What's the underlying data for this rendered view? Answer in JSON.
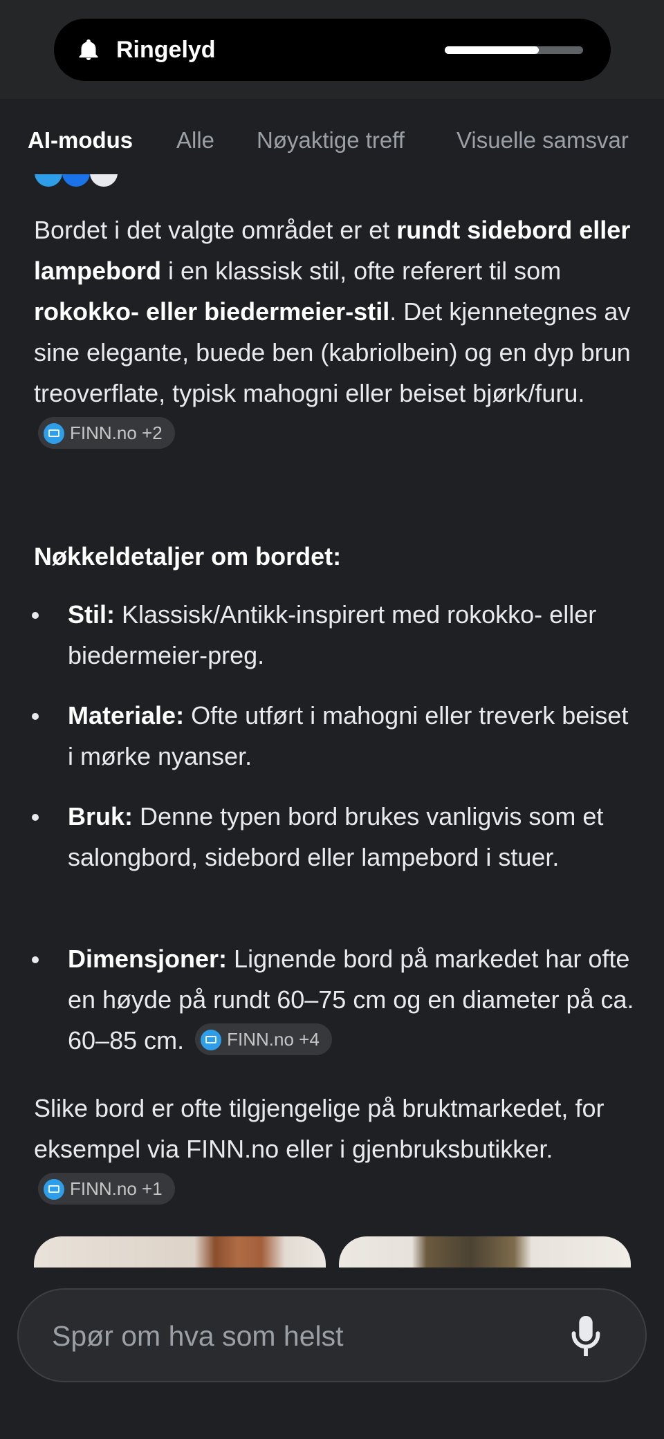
{
  "volume": {
    "label": "Ringelyd",
    "level": 0.68
  },
  "tabs": [
    "AI-modus",
    "Alle",
    "Nøyaktige treff",
    "Visuelle samsvar"
  ],
  "intro": {
    "t1": "Bordet i det valgte området er et ",
    "b1": "rundt sidebord eller lampebord",
    "t2": " i en klassisk stil, ofte referert til som ",
    "b2": "rokokko- eller biedermeier-stil",
    "t3": ". Det kjennetegnes av sine elegante, buede ben (kabriolbein) og en dyp brun treoverflate, typisk mahogni eller beiset bjørk/furu.",
    "chip": "FINN.no +2"
  },
  "details_heading": "Nøkkeldetaljer om bordet:",
  "details": [
    {
      "label": "Stil:",
      "text": " Klassisk/Antikk-inspirert med rokokko- eller biedermeier-preg."
    },
    {
      "label": "Materiale:",
      "text": " Ofte utført i mahogni eller treverk beiset i mørke nyanser."
    },
    {
      "label": "Bruk:",
      "text": " Denne typen bord brukes vanligvis som et salongbord, sidebord eller lampebord i stuer."
    },
    {
      "label": "Dimensjoner:",
      "text": " Lignende bord på markedet har ofte en høyde på rundt 60–75 cm og en diameter på ca. 60–85 cm.",
      "chip": "FINN.no +4"
    }
  ],
  "outro": {
    "text": "Slike bord er ofte tilgjengelige på bruktmarkedet, for eksempel via FINN.no eller i gjenbruksbutikker.",
    "chip": "FINN.no +1"
  },
  "search": {
    "placeholder": "Spør om hva som helst"
  },
  "icons": {
    "bell": "bell-icon",
    "mic": "microphone-icon",
    "source": "finn-source-icon"
  }
}
